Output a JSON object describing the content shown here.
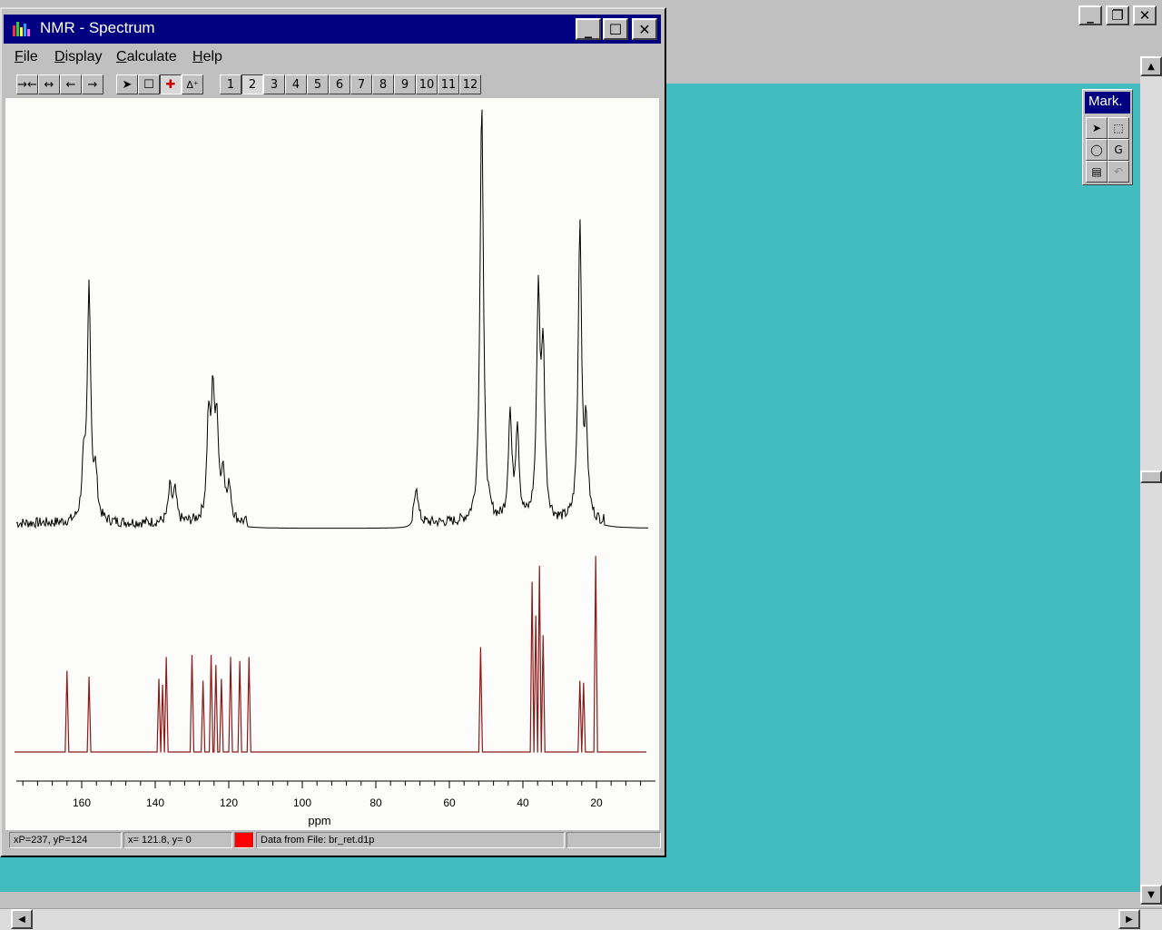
{
  "background_window": {
    "controls": [
      "minimize-icon",
      "restore-icon",
      "close-icon"
    ],
    "viewport_color": "#43bcbf",
    "mark_palette": {
      "title": "Mark.",
      "tools": [
        "select-arrow-icon",
        "box-select-icon",
        "lasso-select-icon",
        "group-select-icon",
        "list-select-icon",
        "undo-select-icon"
      ]
    }
  },
  "nmr_window": {
    "title": "NMR - Spectrum",
    "menu": [
      "File",
      "Display",
      "Calculate",
      "Help"
    ],
    "toolbar": {
      "zoom_tools": [
        "→←",
        "↔",
        "←",
        "→"
      ],
      "mode_tools": [
        "pointer-icon",
        "zoom-box-icon",
        "scale-icon",
        "delta-icon"
      ],
      "pages": [
        "1",
        "2",
        "3",
        "4",
        "5",
        "6",
        "7",
        "8",
        "9",
        "10",
        "11",
        "12"
      ],
      "active_page": "2"
    },
    "status": {
      "pos": "xP=237, yP=124",
      "coords": "x=   121.8, y=       0",
      "file": "Data from File: br_ret.d1p"
    }
  },
  "chart_data": {
    "type": "line",
    "xlabel": "ppm",
    "x_ticks": [
      "160",
      "140",
      "120",
      "100",
      "80",
      "60",
      "40",
      "20"
    ],
    "xlim": [
      178,
      6
    ],
    "axis_direction": "decreasing",
    "series": [
      {
        "kind": "experimental",
        "peaks": [
          {
            "x": 158,
            "h": 0.55
          },
          {
            "x": 159.5,
            "h": 0.12
          },
          {
            "x": 156.2,
            "h": 0.1
          },
          {
            "x": 125.5,
            "h": 0.23
          },
          {
            "x": 124.3,
            "h": 0.27
          },
          {
            "x": 123.2,
            "h": 0.2
          },
          {
            "x": 121.5,
            "h": 0.11
          },
          {
            "x": 119.8,
            "h": 0.08
          },
          {
            "x": 136,
            "h": 0.08
          },
          {
            "x": 134.6,
            "h": 0.07
          },
          {
            "x": 69,
            "h": 0.09
          },
          {
            "x": 51.2,
            "h": 1.0
          },
          {
            "x": 43.5,
            "h": 0.25
          },
          {
            "x": 41.5,
            "h": 0.22
          },
          {
            "x": 35.8,
            "h": 0.52
          },
          {
            "x": 34.5,
            "h": 0.38
          },
          {
            "x": 24.5,
            "h": 0.7
          },
          {
            "x": 22.8,
            "h": 0.2
          }
        ]
      },
      {
        "kind": "calculated",
        "peaks": [
          {
            "x": 164,
            "h": 0.41
          },
          {
            "x": 158,
            "h": 0.38
          },
          {
            "x": 139,
            "h": 0.37
          },
          {
            "x": 138,
            "h": 0.34
          },
          {
            "x": 137,
            "h": 0.48
          },
          {
            "x": 130,
            "h": 0.49
          },
          {
            "x": 127,
            "h": 0.36
          },
          {
            "x": 124.8,
            "h": 0.49
          },
          {
            "x": 123.5,
            "h": 0.44
          },
          {
            "x": 122,
            "h": 0.37
          },
          {
            "x": 119.5,
            "h": 0.48
          },
          {
            "x": 117,
            "h": 0.46
          },
          {
            "x": 114.5,
            "h": 0.48
          },
          {
            "x": 51.5,
            "h": 0.53
          },
          {
            "x": 37.5,
            "h": 0.86
          },
          {
            "x": 36.5,
            "h": 0.69
          },
          {
            "x": 35.5,
            "h": 0.94
          },
          {
            "x": 34.5,
            "h": 0.59
          },
          {
            "x": 24.5,
            "h": 0.36
          },
          {
            "x": 23.5,
            "h": 0.35
          },
          {
            "x": 20.2,
            "h": 0.99
          }
        ]
      }
    ],
    "colors": {
      "experimental": "#000000",
      "calculated": "#8b1a1a",
      "status_swatch": "#ff0000"
    }
  }
}
